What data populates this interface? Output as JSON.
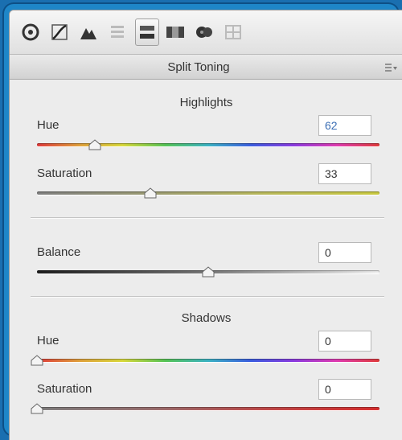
{
  "panel": {
    "title": "Split Toning",
    "toolbar_icons": [
      {
        "name": "basic-icon"
      },
      {
        "name": "tone-curve-icon"
      },
      {
        "name": "detail-icon"
      },
      {
        "name": "hsl-icon"
      },
      {
        "name": "split-toning-icon"
      },
      {
        "name": "lens-corrections-icon"
      },
      {
        "name": "effects-icon"
      },
      {
        "name": "camera-calibration-icon"
      }
    ]
  },
  "highlights": {
    "heading": "Highlights",
    "hue": {
      "label": "Hue",
      "value": "62",
      "level": 0.17
    },
    "saturation": {
      "label": "Saturation",
      "value": "33",
      "level": 0.33
    }
  },
  "balance": {
    "label": "Balance",
    "value": "0",
    "level": 0.5
  },
  "shadows": {
    "heading": "Shadows",
    "hue": {
      "label": "Hue",
      "value": "0",
      "level": 0
    },
    "saturation": {
      "label": "Saturation",
      "value": "0",
      "level": 0
    }
  },
  "colors": {
    "frame": "#1e86c8",
    "panel_bg": "#ececec",
    "value_highlight": "#3c6fb5"
  }
}
